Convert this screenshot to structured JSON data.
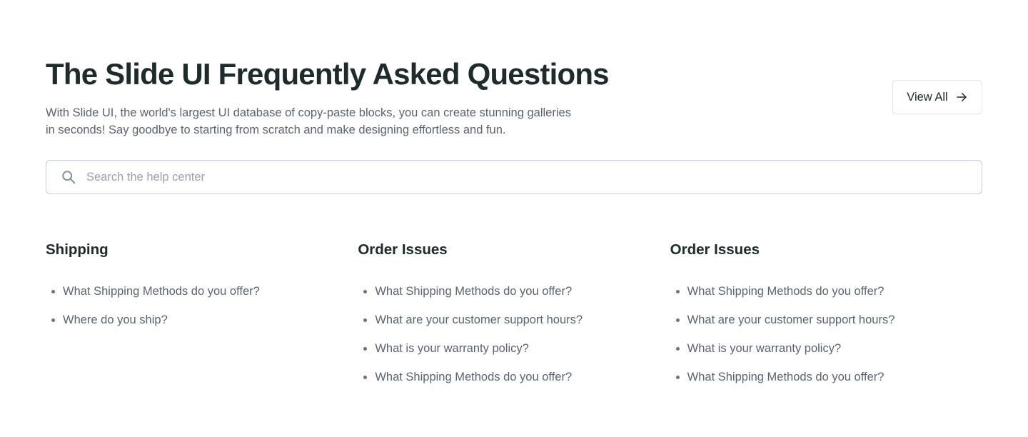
{
  "header": {
    "title": "The Slide UI Frequently Asked Questions",
    "subtitle_line1": "With Slide UI, the world's largest UI database of copy-paste blocks, you can create stunning galleries",
    "subtitle_line2": "in seconds! Say goodbye to starting from scratch and make designing effortless and fun.",
    "view_all_label": "View All",
    "view_all_icon": "arrow-right-icon"
  },
  "search": {
    "placeholder": "Search the help center",
    "value": "",
    "icon": "search-icon"
  },
  "columns": [
    {
      "title": "Shipping",
      "items": [
        "What Shipping Methods do you offer?",
        "Where do you ship?"
      ]
    },
    {
      "title": "Order Issues",
      "items": [
        "What Shipping Methods do you offer?",
        "What are your customer support hours?",
        "What is your warranty policy?",
        "What Shipping Methods do you offer?"
      ]
    },
    {
      "title": "Order Issues",
      "items": [
        "What Shipping Methods do you offer?",
        "What are your customer support hours?",
        "What is your warranty policy?",
        "What Shipping Methods do you offer?"
      ]
    }
  ],
  "colors": {
    "text_primary": "#1f2a2a",
    "text_secondary": "#5b6370",
    "border": "#c9ced4"
  }
}
